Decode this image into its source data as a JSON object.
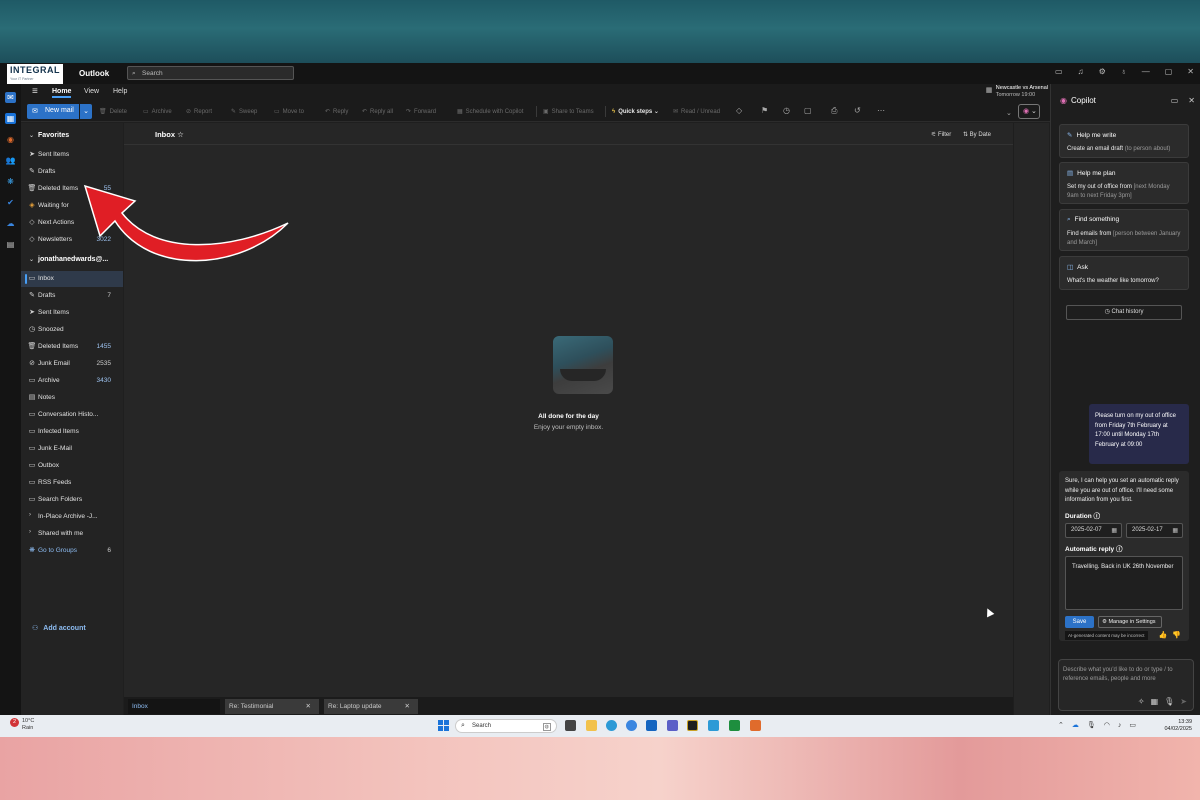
{
  "titlebar": {
    "logo_main": "INTEGRAL",
    "logo_tag": "Your IT Partner",
    "app_name": "Outlook",
    "search_placeholder": "Search"
  },
  "menu": {
    "items": [
      "Home",
      "View",
      "Help"
    ],
    "active": "Home",
    "event_title": "Newcastle vs Arsenal",
    "event_time": "Tomorrow 19:00"
  },
  "ribbon": {
    "new_mail": "New mail",
    "buttons": [
      "Delete",
      "Archive",
      "Report",
      "Sweep",
      "Move to",
      "Reply",
      "Reply all",
      "Forward",
      "Schedule with Copilot",
      "Share to Teams",
      "Quick steps",
      "Read / Unread"
    ]
  },
  "favorites": {
    "header": "Favorites",
    "items": [
      {
        "label": "Sent Items",
        "count": ""
      },
      {
        "label": "Drafts",
        "count": ""
      },
      {
        "label": "Deleted Items",
        "count": "55"
      },
      {
        "label": "Waiting for",
        "count": ""
      },
      {
        "label": "Next Actions",
        "count": ""
      },
      {
        "label": "Newsletters",
        "count": "3022"
      }
    ]
  },
  "account": {
    "header": "jonathanedwards@...",
    "items": [
      {
        "label": "Inbox",
        "count": ""
      },
      {
        "label": "Drafts",
        "count": "7"
      },
      {
        "label": "Sent Items",
        "count": ""
      },
      {
        "label": "Snoozed",
        "count": ""
      },
      {
        "label": "Deleted Items",
        "count": "1455"
      },
      {
        "label": "Junk Email",
        "count": "2535"
      },
      {
        "label": "Archive",
        "count": "3430"
      },
      {
        "label": "Notes",
        "count": ""
      },
      {
        "label": "Conversation Histo...",
        "count": ""
      },
      {
        "label": "Infected Items",
        "count": ""
      },
      {
        "label": "Junk E-Mail",
        "count": ""
      },
      {
        "label": "Outbox",
        "count": ""
      },
      {
        "label": "RSS Feeds",
        "count": ""
      },
      {
        "label": "Search Folders",
        "count": ""
      },
      {
        "label": "In-Place Archive -J...",
        "count": ""
      },
      {
        "label": "Shared with me",
        "count": ""
      },
      {
        "label": "Go to Groups",
        "count": "6"
      }
    ],
    "add_account": "Add account"
  },
  "main": {
    "title": "Inbox",
    "filter": "Filter",
    "sort": "By Date",
    "empty_title": "All done for the day",
    "empty_sub": "Enjoy your empty inbox."
  },
  "tabs": [
    {
      "label": "Inbox"
    },
    {
      "label": "Re: Testimonial"
    },
    {
      "label": "Re: Laptop update"
    }
  ],
  "copilot": {
    "title": "Copilot",
    "cards": [
      {
        "title": "Help me write",
        "desc": "Create an email draft",
        "hint": "(to person about)"
      },
      {
        "title": "Help me plan",
        "desc": "Set my out of office from",
        "hint": "[next Monday 9am to next Friday 3pm]"
      },
      {
        "title": "Find something",
        "desc": "Find emails from",
        "hint": "[person between January and March]"
      },
      {
        "title": "Ask",
        "desc": "What's the weather like tomorrow?",
        "hint": ""
      }
    ],
    "chat_history": "Chat history",
    "user_message": "Please turn on my out of office from Friday 7th February at 17:00 until Monday 17th February at 09:00",
    "reply_text": "Sure, I can help you set an automatic reply while you are out of office. I'll need some information from you first.",
    "duration_label": "Duration",
    "start_date": "2025-02-07",
    "end_date": "2025-02-17",
    "auto_reply_label": "Automatic reply",
    "auto_reply_text": "Travelling. Back in UK 26th November",
    "save": "Save",
    "manage_settings": "Manage in Settings",
    "ai_note": "AI-generated content may be incorrect",
    "input_placeholder": "Describe what you'd like to do or type / to reference emails, people and more"
  },
  "taskbar": {
    "notif_count": "2",
    "temp": "10°C",
    "weather": "Rain",
    "search": "Search",
    "time": "13:39",
    "date": "04/02/2025"
  },
  "colors": {
    "accent": "#2c72c7",
    "annotation_arrow": "#e01e25"
  }
}
